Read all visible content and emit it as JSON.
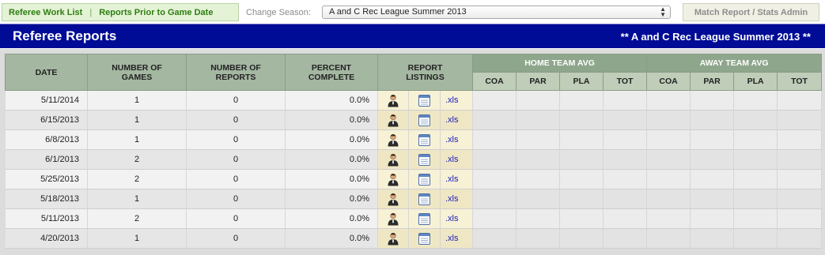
{
  "nav": {
    "link1": "Referee Work List",
    "separator": "|",
    "link2": "Reports Prior to Game Date",
    "season_label": "Change Season:",
    "season_value": "A and C Rec League Summer 2013",
    "right_link": "Match Report / Stats Admin"
  },
  "header": {
    "title": "Referee Reports",
    "subtitle": "** A and C Rec League Summer 2013 **"
  },
  "columns": {
    "date": "DATE",
    "games_l1": "NUMBER OF",
    "games_l2": "GAMES",
    "reports_l1": "NUMBER OF",
    "reports_l2": "REPORTS",
    "percent_l1": "PERCENT",
    "percent_l2": "COMPLETE",
    "listings_l1": "REPORT",
    "listings_l2": "LISTINGS",
    "home_group": "HOME TEAM AVG",
    "away_group": "AWAY TEAM AVG",
    "coa": "COA",
    "par": "PAR",
    "pla": "PLA",
    "tot": "TOT"
  },
  "rows": [
    {
      "date": "5/11/2014",
      "games": "1",
      "reports": "0",
      "percent": "0.0%",
      "xls": ".xls"
    },
    {
      "date": "6/15/2013",
      "games": "1",
      "reports": "0",
      "percent": "0.0%",
      "xls": ".xls"
    },
    {
      "date": "6/8/2013",
      "games": "1",
      "reports": "0",
      "percent": "0.0%",
      "xls": ".xls"
    },
    {
      "date": "6/1/2013",
      "games": "2",
      "reports": "0",
      "percent": "0.0%",
      "xls": ".xls"
    },
    {
      "date": "5/25/2013",
      "games": "2",
      "reports": "0",
      "percent": "0.0%",
      "xls": ".xls"
    },
    {
      "date": "5/18/2013",
      "games": "1",
      "reports": "0",
      "percent": "0.0%",
      "xls": ".xls"
    },
    {
      "date": "5/11/2013",
      "games": "2",
      "reports": "0",
      "percent": "0.0%",
      "xls": ".xls"
    },
    {
      "date": "4/20/2013",
      "games": "1",
      "reports": "0",
      "percent": "0.0%",
      "xls": ".xls"
    }
  ],
  "icons": {
    "referee": "referee-person-icon",
    "report": "report-window-icon",
    "select_arrows": "updown-chevron-icon"
  }
}
